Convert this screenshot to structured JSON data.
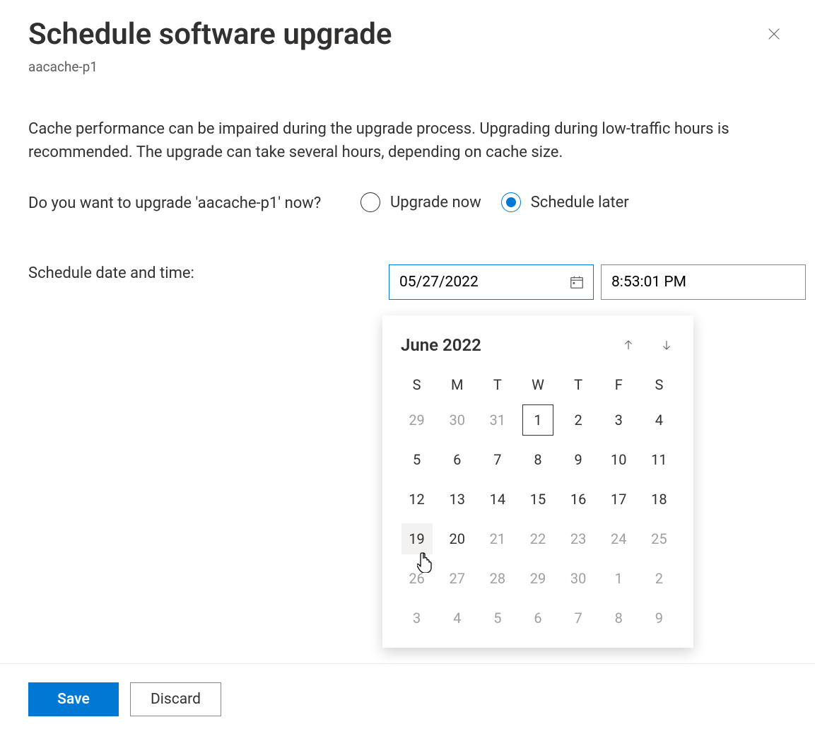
{
  "header": {
    "title": "Schedule software upgrade",
    "resource": "aacache-p1"
  },
  "description": "Cache performance can be impaired during the upgrade process. Upgrading during low-traffic hours is recommended. The upgrade can take several hours, depending on cache size.",
  "form": {
    "question": "Do you want to upgrade 'aacache-p1' now?",
    "option_now": "Upgrade now",
    "option_later": "Schedule later",
    "selected_option": "later",
    "schedule_label": "Schedule date and time:",
    "date_value": "05/27/2022",
    "time_value": "8:53:01 PM"
  },
  "calendar": {
    "month_label": "June 2022",
    "day_headers": [
      "S",
      "M",
      "T",
      "W",
      "T",
      "F",
      "S"
    ],
    "weeks": [
      [
        {
          "d": "29",
          "o": true
        },
        {
          "d": "30",
          "o": true
        },
        {
          "d": "31",
          "o": true
        },
        {
          "d": "1",
          "today": true
        },
        {
          "d": "2"
        },
        {
          "d": "3"
        },
        {
          "d": "4"
        }
      ],
      [
        {
          "d": "5"
        },
        {
          "d": "6"
        },
        {
          "d": "7"
        },
        {
          "d": "8"
        },
        {
          "d": "9"
        },
        {
          "d": "10"
        },
        {
          "d": "11"
        }
      ],
      [
        {
          "d": "12"
        },
        {
          "d": "13"
        },
        {
          "d": "14"
        },
        {
          "d": "15"
        },
        {
          "d": "16"
        },
        {
          "d": "17"
        },
        {
          "d": "18"
        }
      ],
      [
        {
          "d": "19",
          "hov": true
        },
        {
          "d": "20"
        },
        {
          "d": "21",
          "o": true
        },
        {
          "d": "22",
          "o": true
        },
        {
          "d": "23",
          "o": true
        },
        {
          "d": "24",
          "o": true
        },
        {
          "d": "25",
          "o": true
        }
      ],
      [
        {
          "d": "26",
          "o": true
        },
        {
          "d": "27",
          "o": true
        },
        {
          "d": "28",
          "o": true
        },
        {
          "d": "29",
          "o": true
        },
        {
          "d": "30",
          "o": true
        },
        {
          "d": "1",
          "o": true
        },
        {
          "d": "2",
          "o": true
        }
      ],
      [
        {
          "d": "3",
          "o": true
        },
        {
          "d": "4",
          "o": true
        },
        {
          "d": "5",
          "o": true
        },
        {
          "d": "6",
          "o": true
        },
        {
          "d": "7",
          "o": true
        },
        {
          "d": "8",
          "o": true
        },
        {
          "d": "9",
          "o": true
        }
      ]
    ]
  },
  "footer": {
    "save": "Save",
    "discard": "Discard"
  }
}
